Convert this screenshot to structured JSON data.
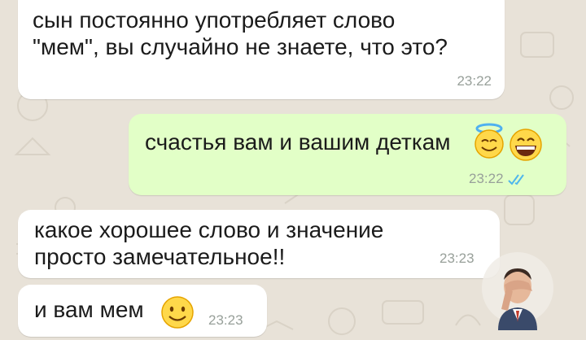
{
  "chat": {
    "messages": [
      {
        "direction": "incoming",
        "text": "сын постоянно употребляет слово\n\"мем\", вы случайно не знаете, что это?",
        "time": "23:22"
      },
      {
        "direction": "outgoing",
        "text": "счастья вам и вашим деткам",
        "emojis": [
          "smiling-face-with-halo",
          "grinning-face"
        ],
        "time": "23:22",
        "status": "read"
      },
      {
        "direction": "incoming",
        "text": "какое хорошее слово и значение\nпросто замечательное!!",
        "time": "23:23"
      },
      {
        "direction": "incoming",
        "text": "и вам мем",
        "emojis": [
          "smiling-face"
        ],
        "time": "23:23"
      }
    ]
  },
  "colors": {
    "chat_background": "#e8e2d8",
    "incoming_bubble": "#ffffff",
    "outgoing_bubble": "#e2ffc7",
    "read_ticks": "#4fb6ec",
    "timestamp": "#98a09a"
  },
  "icons": [
    "smiling-face-with-halo-icon",
    "grinning-face-icon",
    "smiling-face-icon",
    "double-check-read-icon",
    "facepalm-sticker-icon"
  ]
}
